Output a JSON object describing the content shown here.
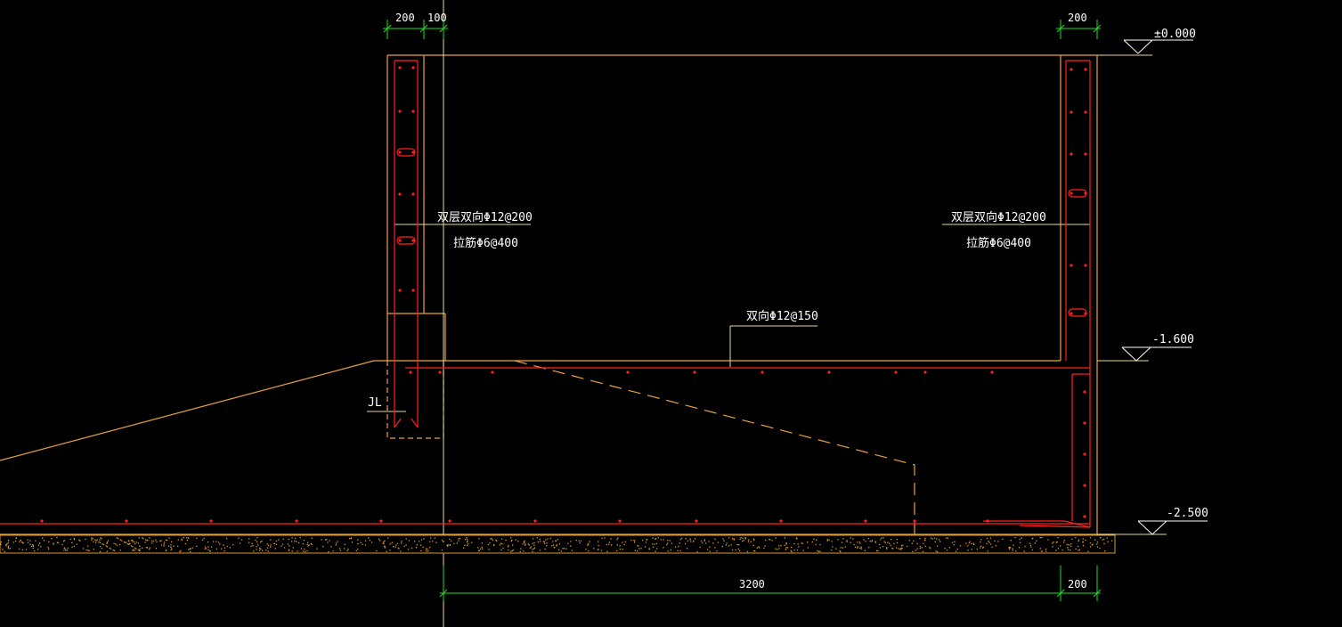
{
  "dimensions": {
    "top_left_a": "200",
    "top_left_b": "100",
    "top_right": "200",
    "bottom_main": "3200",
    "bottom_right": "200"
  },
  "elevations": {
    "top": "±0.000",
    "middle": "-1.600",
    "bottom": "-2.500"
  },
  "rebar_notes": {
    "left_main": "双层双向Φ12@200",
    "left_tie": "拉筋Φ6@400",
    "right_main": "双层双向Φ12@200",
    "right_tie": "拉筋Φ6@400",
    "slab": "双向Φ12@150"
  },
  "labels": {
    "beam": "JL"
  },
  "colors": {
    "background": "#000000",
    "outline": "#e8a23c",
    "rebar": "#ff2020",
    "dimension": "#22dd22",
    "text": "#ffffff",
    "leader": "#e8d8a0",
    "soil_hatch": "#d99a2b"
  }
}
